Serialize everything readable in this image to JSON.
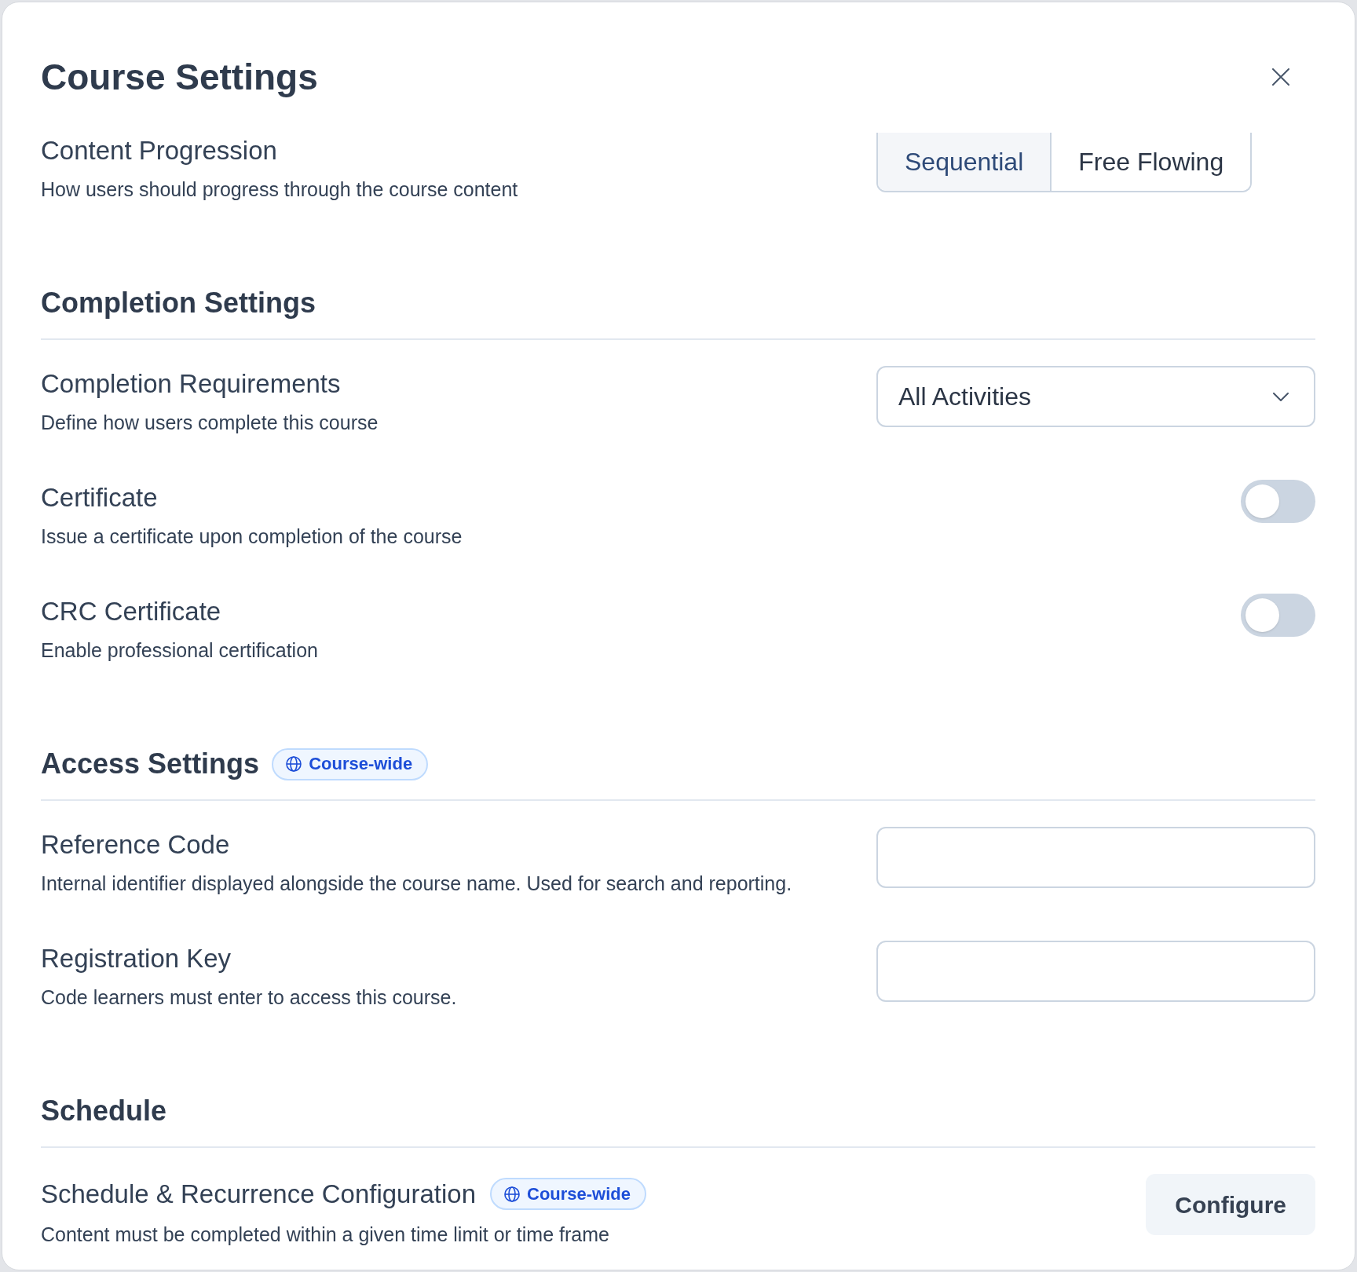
{
  "dialog": {
    "title": "Course Settings"
  },
  "sections": [
    {
      "rows": [
        {
          "kind": "segmented",
          "label": "Content Progression",
          "description": "How users should progress through the course content",
          "options": [
            {
              "label": "Sequential",
              "selected": true
            },
            {
              "label": "Free Flowing",
              "selected": false
            }
          ]
        }
      ]
    },
    {
      "heading": "Completion Settings",
      "rows": [
        {
          "kind": "select",
          "label": "Completion Requirements",
          "description": "Define how users complete this course",
          "value": "All Activities"
        },
        {
          "kind": "toggle",
          "label": "Certificate",
          "description": "Issue a certificate upon completion of the course",
          "on": false
        },
        {
          "kind": "toggle",
          "label": "CRC Certificate",
          "description": "Enable professional certification",
          "on": false
        }
      ]
    },
    {
      "heading": "Access Settings",
      "badge": "Course-wide",
      "rows": [
        {
          "kind": "text_input",
          "label": "Reference Code",
          "description": "Internal identifier displayed alongside the course name. Used for search and reporting."
        },
        {
          "kind": "text_input",
          "label": "Registration Key",
          "description": "Code learners must enter to access this course."
        }
      ]
    },
    {
      "heading": "Schedule",
      "rows": [
        {
          "kind": "button",
          "label": "Schedule & Recurrence Configuration",
          "badge": "Course-wide",
          "description": "Content must be completed within a given time limit or time frame",
          "button": "Configure"
        }
      ]
    }
  ]
}
